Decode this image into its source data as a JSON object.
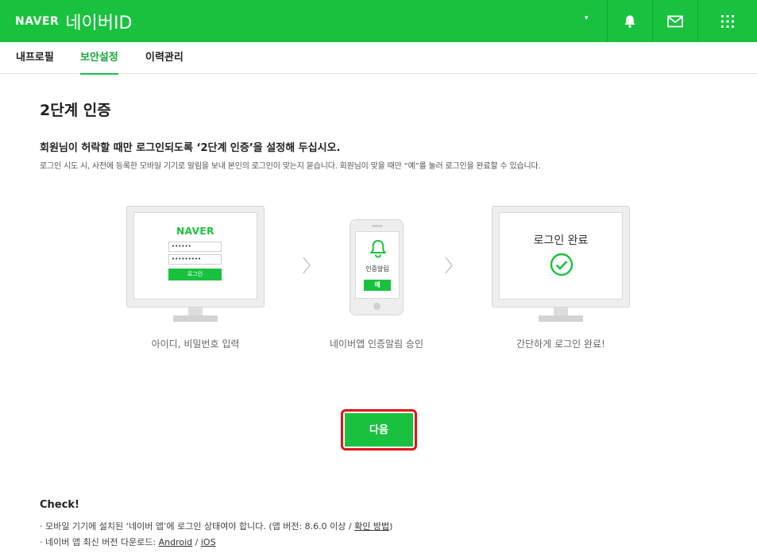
{
  "header": {
    "brand": "NAVER",
    "service_title": "네이버ID",
    "account_caret": "▾",
    "colors": {
      "brand_green": "#19c23e",
      "header_divider": "#14a534"
    },
    "icons": [
      "chevron-down-icon",
      "bell-icon",
      "mail-icon",
      "grid-menu-icon"
    ]
  },
  "tabs": [
    {
      "label": "내프로필",
      "active": false
    },
    {
      "label": "보안설정",
      "active": true
    },
    {
      "label": "이력관리",
      "active": false
    }
  ],
  "main": {
    "title": "2단계 인증",
    "headline": "회원님이 허락할 때만 로그인되도록 ‘2단계 인증’을 설정해 두십시오.",
    "description": "로그인 시도 시, 사전에 등록한 모바일 기기로 알림을 보내 본인의 로그인이 맞는지 묻습니다. 회원님이 맞을 때만 “예”를 눌러 로그인을 완료할 수 있습니다."
  },
  "steps": {
    "step1": {
      "logo": "NAVER",
      "id_value": "••••••",
      "pw_value": "•••••••••",
      "login_button": "로그인",
      "caption": "아이디, 비밀번호 입력"
    },
    "step2": {
      "alert_label": "인증알림",
      "yes_button": "예",
      "caption": "네이버앱 인증알림 승인"
    },
    "step3": {
      "done_text": "로그인 완료",
      "caption": "간단하게 로그인 완료!"
    }
  },
  "actions": {
    "next_label": "다음",
    "highlight_color": "#e0141b"
  },
  "check": {
    "title": "Check!",
    "note1_prefix": "· 모바일 기기에 설치된 ‘네이버 앱’에 로그인 상태여야 합니다. (앱 버전: 8.6.0 이상 / ",
    "note1_link": "확인 방법",
    "note1_suffix": ")",
    "note2_prefix": "· 네이버 앱 최신 버전 다운로드: ",
    "android_link": "Android",
    "separator": " / ",
    "ios_link": "iOS"
  }
}
